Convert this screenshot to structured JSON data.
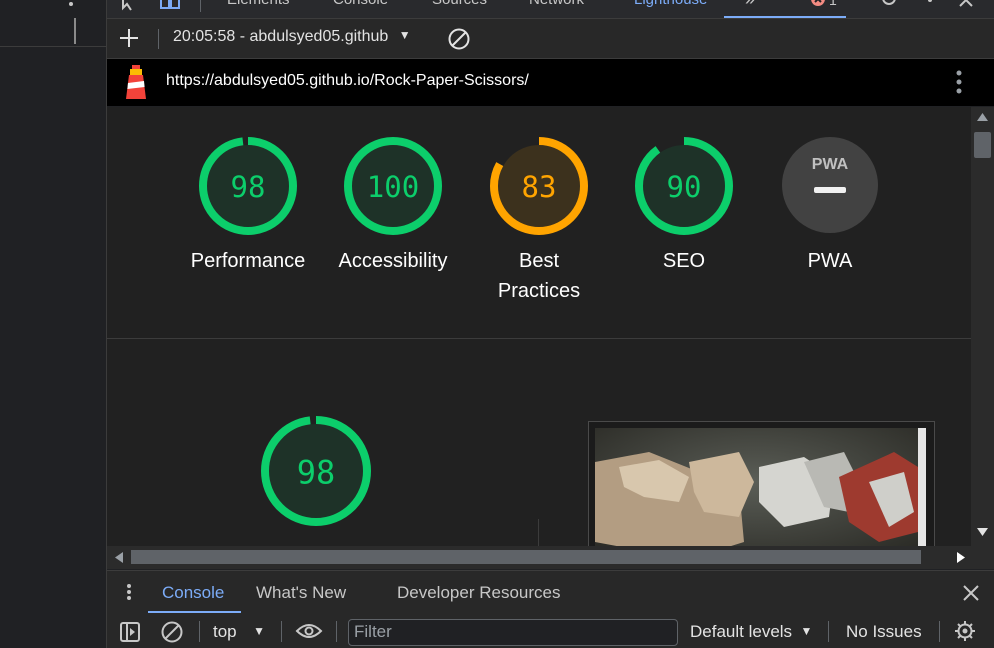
{
  "devtools": {
    "tabs": [
      "Elements",
      "Console",
      "Sources",
      "Network",
      "Lighthouse"
    ],
    "active_tab": "Lighthouse",
    "error_count": "1"
  },
  "lighthouse": {
    "report_select": "20:05:58 - abdulsyed05.github",
    "url": "https://abdulsyed05.github.io/Rock-Paper-Scissors/",
    "gauges": [
      {
        "score": "98",
        "label": "Performance",
        "status": "pass",
        "color": "#0cce6b",
        "fraction": 0.98
      },
      {
        "score": "100",
        "label": "Accessibility",
        "status": "pass",
        "color": "#0cce6b",
        "fraction": 1.0
      },
      {
        "score": "83",
        "label": "Best Practices",
        "status": "average",
        "color": "#ffa400",
        "fraction": 0.83
      },
      {
        "score": "90",
        "label": "SEO",
        "status": "pass",
        "color": "#0cce6b",
        "fraction": 0.9
      },
      {
        "label": "PWA",
        "badge_text": "PWA",
        "status": "na"
      }
    ],
    "main_gauge": {
      "score": "98",
      "color": "#0cce6b",
      "fraction": 0.98
    }
  },
  "drawer": {
    "tabs": [
      "Console",
      "What's New",
      "Developer Resources"
    ],
    "active_tab": "Console"
  },
  "console_toolbar": {
    "context": "top",
    "filter_placeholder": "Filter",
    "levels": "Default levels",
    "issues": "No Issues"
  },
  "colors": {
    "pass": "#0cce6b",
    "average": "#ffa400",
    "accent": "#7cacf8"
  }
}
